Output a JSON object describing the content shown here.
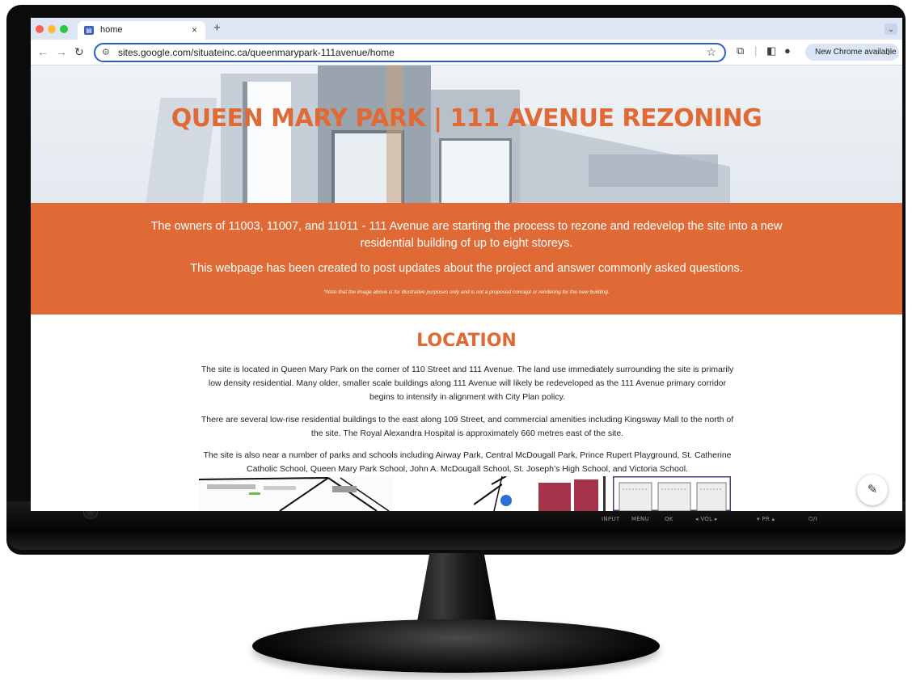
{
  "browser": {
    "tab": {
      "title": "home",
      "close": "×"
    },
    "new_tab": "+",
    "tab_menu": "⌄",
    "url": "sites.google.com/situateinc.ca/queenmarypark-111avenue/home",
    "update_button": "New Chrome available",
    "update_menu": "⋮"
  },
  "monitor": {
    "buttons": [
      "INPUT",
      "MENU",
      "OK",
      "◂  VOL  ▸",
      "▾  PR  ▴",
      "⏻/I"
    ]
  },
  "page": {
    "hero_title": "QUEEN MARY PARK | 111 AVENUE REZONING",
    "banner": {
      "p1": "The owners of 11003, 11007, and 11011 - 111 Avenue are starting the process to rezone and redevelop the site into a new residential building of up to eight storeys.",
      "p2": "This webpage has been created to post updates about the project and answer commonly asked questions.",
      "note": "*Note that the image above is for illustrative purposes only and is not a proposed concept or rendering for the new building."
    },
    "location": {
      "title": "LOCATION",
      "p1": "The site is located in Queen Mary Park on the corner of 110 Street and 111 Avenue. The land use immediately surrounding the site is primarily low density residential. Many older, smaller scale buildings along 111 Avenue will likely be redeveloped as the 111 Avenue primary corridor begins to intensify in alignment with City Plan policy.",
      "p2": "There are several low-rise residential buildings to the east along 109 Street, and commercial amenities including Kingsway Mall to the north of the site. The Royal Alexandra Hospital is approximately 660 metres east of the site.",
      "p3": "The site is also near a number of parks and schools including Airway Park, Central McDougall Park, Prince Rupert Playground, St. Catherine Catholic School, Queen Mary Park School, John A. McDougall School, St. Joseph’s High School, and Victoria School."
    }
  },
  "colors": {
    "accent": "#e06a36",
    "omnibox_border": "#2d5bd0",
    "tabbar": "#dfe6f3"
  }
}
